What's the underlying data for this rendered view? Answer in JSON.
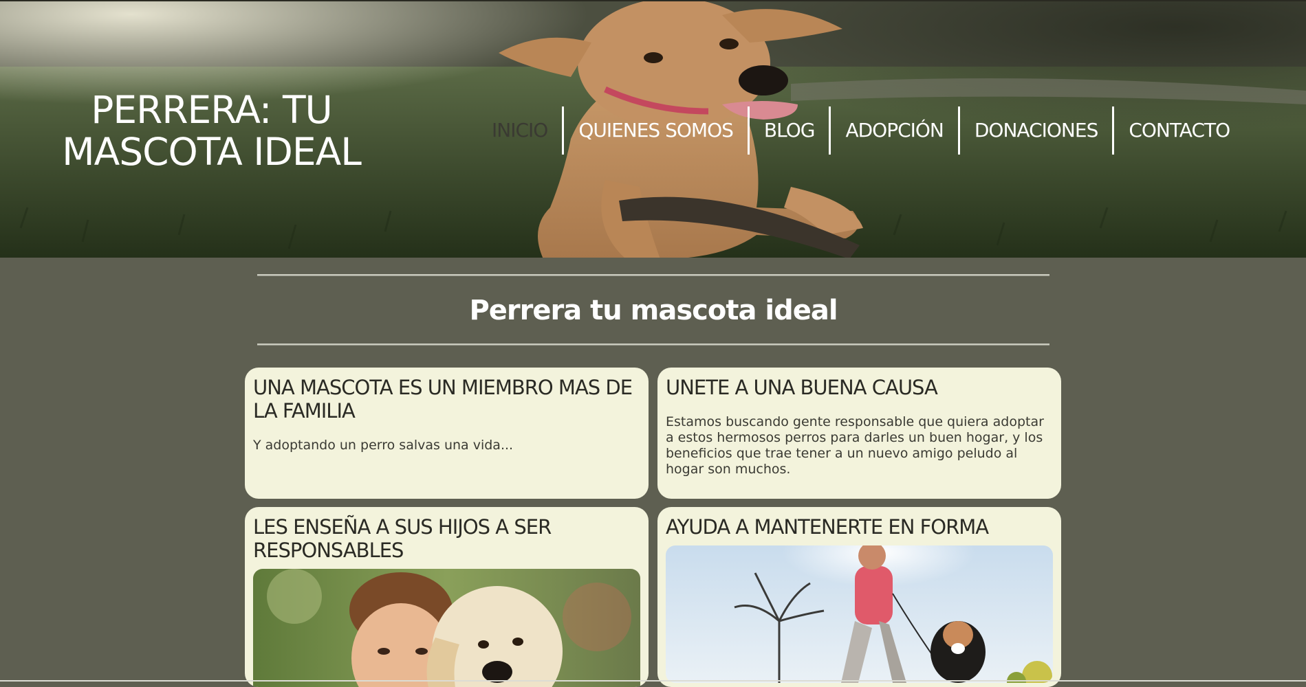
{
  "header": {
    "title": "PERRERA: TU MASCOTA IDEAL",
    "nav": [
      {
        "label": "INICIO",
        "active": true
      },
      {
        "label": "QUIENES SOMOS",
        "active": false
      },
      {
        "label": "BLOG",
        "active": false
      },
      {
        "label": "ADOPCIÓN",
        "active": false
      },
      {
        "label": "DONACIONES",
        "active": false
      },
      {
        "label": "CONTACTO",
        "active": false
      }
    ]
  },
  "main": {
    "title": "Perrera tu mascota ideal",
    "cards": [
      {
        "heading": "UNA MASCOTA ES UN MIEMBRO MAS DE LA FAMILIA",
        "text": "Y adoptando un perro salvas una vida..."
      },
      {
        "heading": "UNETE A UNA BUENA CAUSA",
        "text": "Estamos buscando gente responsable que quiera adoptar a estos hermosos perros para darles un buen hogar, y los beneficios que trae tener a un nuevo amigo peludo al hogar son muchos."
      },
      {
        "heading": "LES ENSEÑA A SUS HIJOS A SER RESPONSABLES",
        "image": "boy-with-golden-retriever-photo"
      },
      {
        "heading": "AYUDA A MANTENERTE EN FORMA",
        "image": "woman-running-with-dog-photo"
      }
    ]
  },
  "colors": {
    "page_background": "#5e5f51",
    "card_background": "#f3f3dc",
    "title_text": "#ffffff",
    "card_text": "#2a2a24"
  }
}
